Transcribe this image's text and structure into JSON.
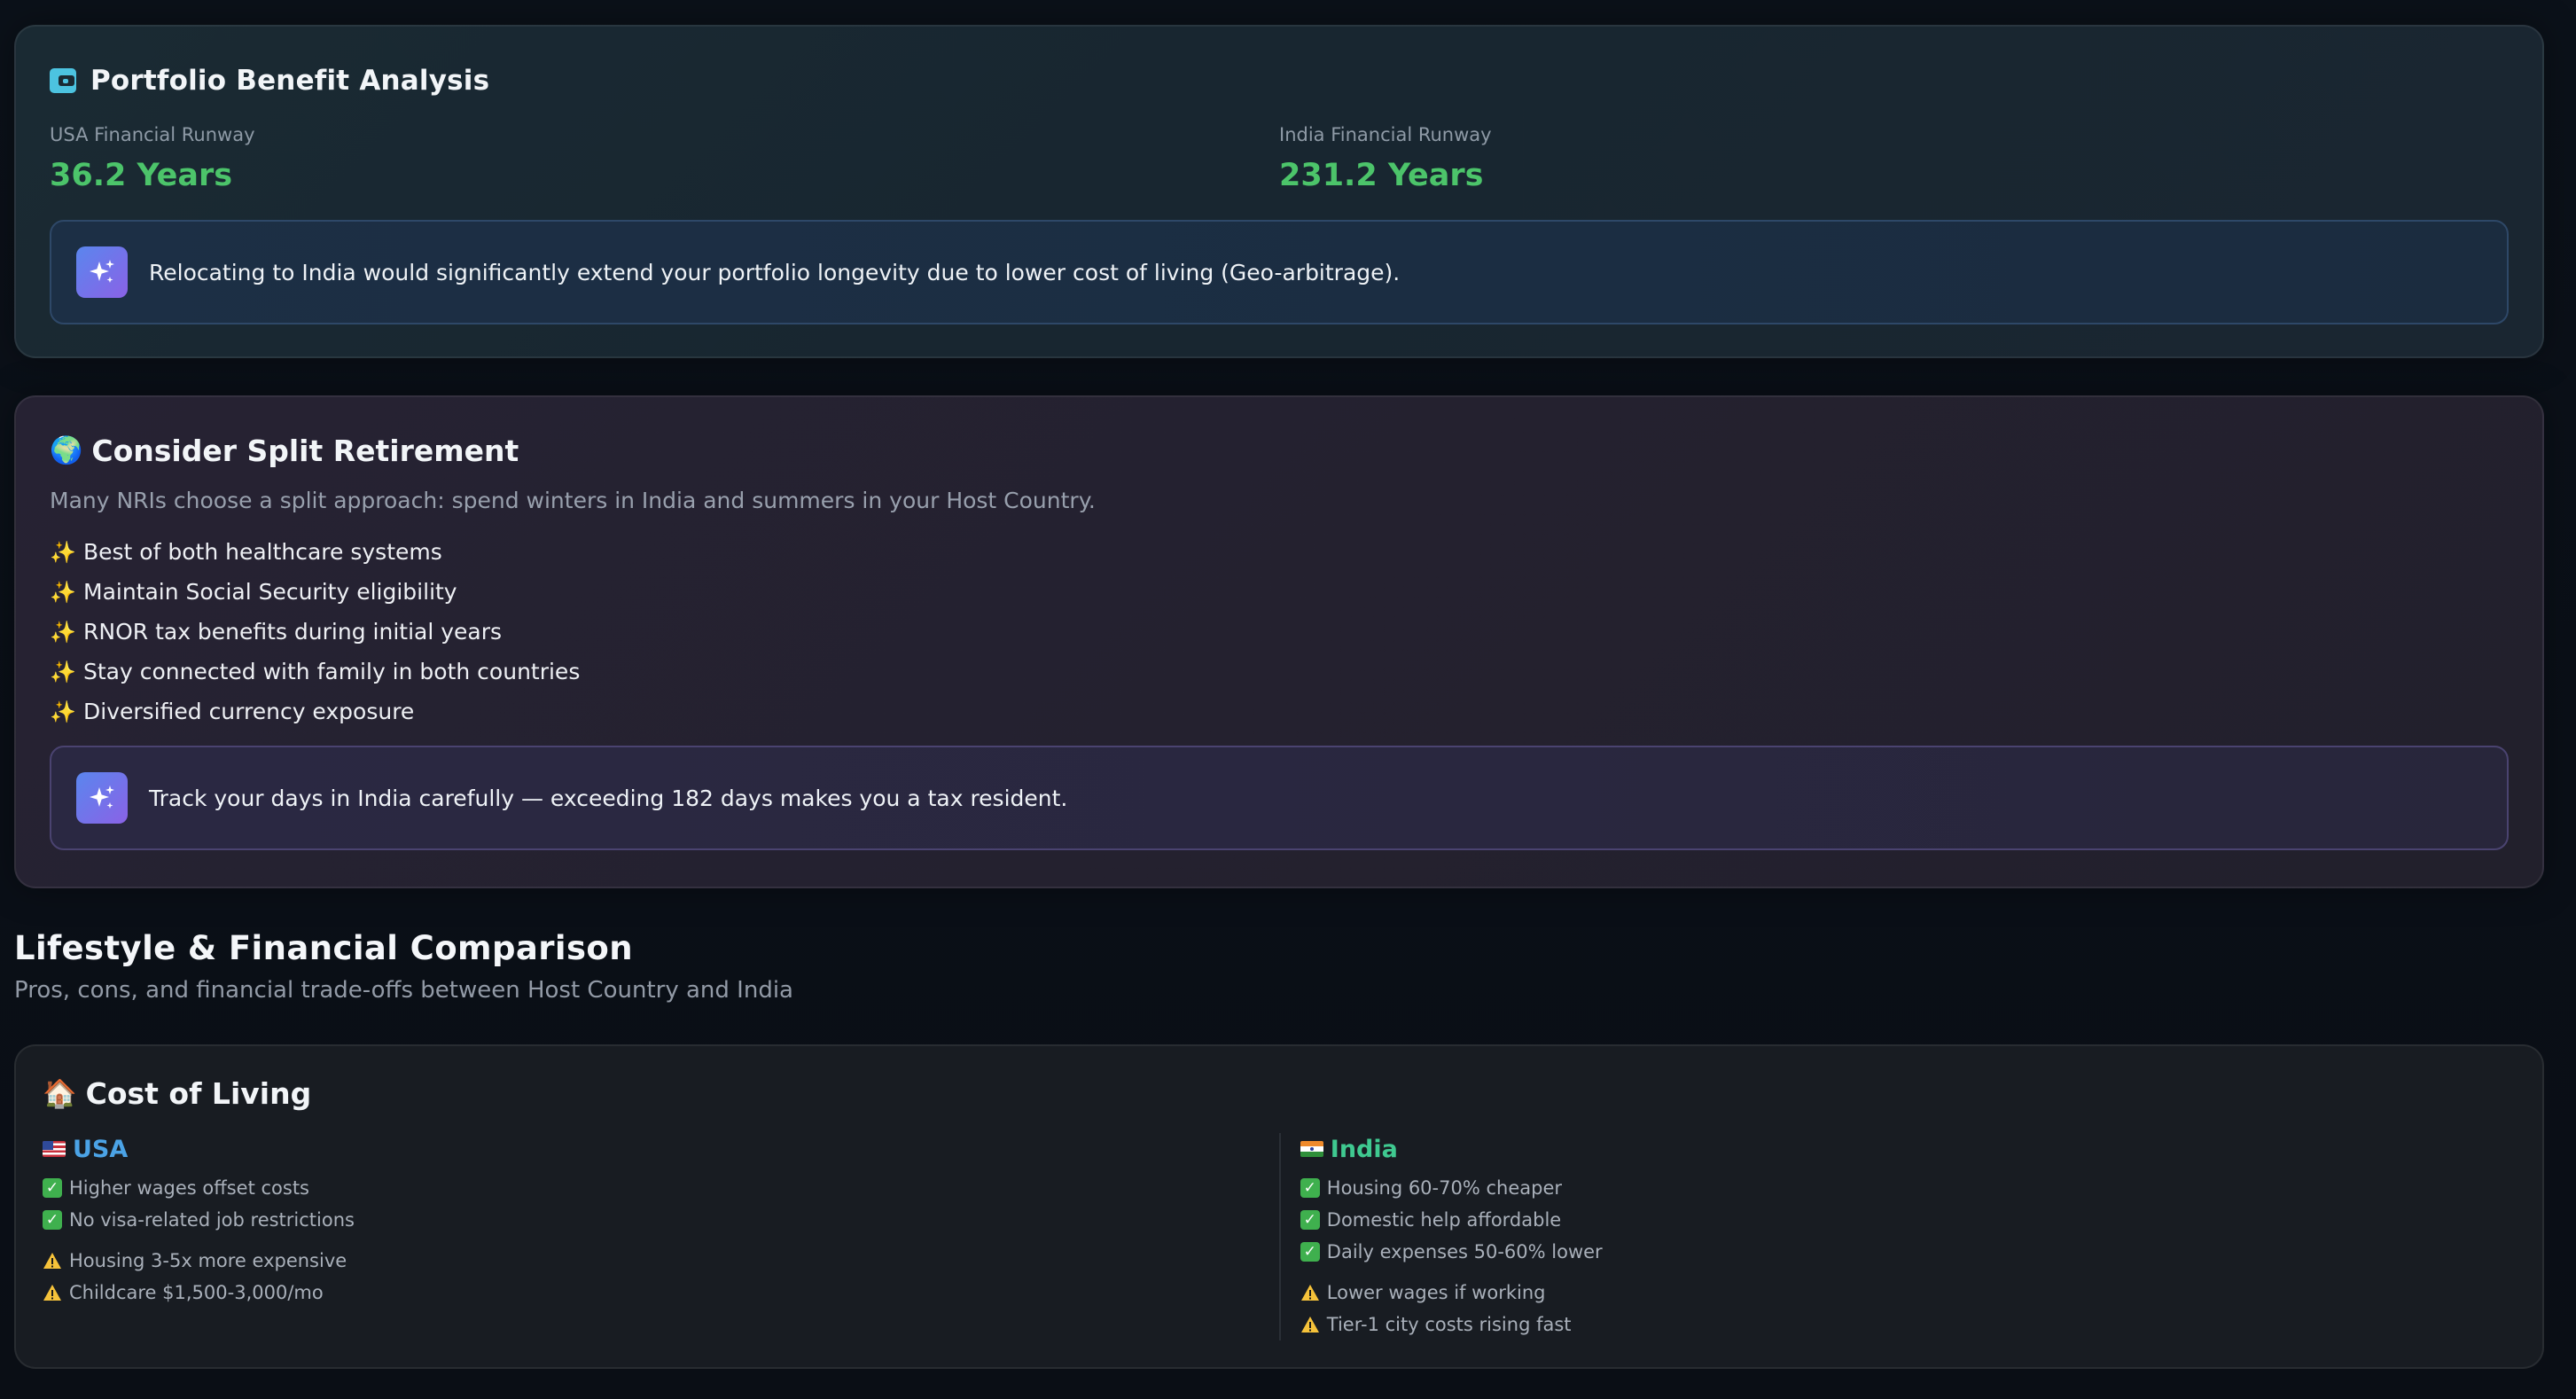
{
  "portfolio": {
    "title": "Portfolio Benefit Analysis",
    "icon": "wallet-icon",
    "usa_label": "USA Financial Runway",
    "usa_value": "36.2 Years",
    "india_label": "India Financial Runway",
    "india_value": "231.2 Years",
    "insight": "Relocating to India would significantly extend your portfolio longevity due to lower cost of living (Geo-arbitrage).",
    "accent_color": "#4cc46a"
  },
  "split": {
    "icon": "🌍",
    "title": "Consider Split Retirement",
    "intro": "Many NRIs choose a split approach: spend winters in India and summers in your Host Country.",
    "bullet_icon": "✨",
    "items": [
      "Best of both healthcare systems",
      "Maintain Social Security eligibility",
      "RNOR tax benefits during initial years",
      "Stay connected with family in both countries",
      "Diversified currency exposure"
    ],
    "insight": "Track your days in India carefully — exceeding 182 days makes you a tax resident."
  },
  "comparison": {
    "title": "Lifestyle & Financial Comparison",
    "subtitle": "Pros, cons, and financial trade-offs between Host Country and India"
  },
  "cost": {
    "icon": "🏠",
    "title": "Cost of Living",
    "usa": {
      "name": "USA",
      "color": "#4ba3e6",
      "pros": [
        "Higher wages offset costs",
        "No visa-related job restrictions"
      ],
      "cons": [
        "Housing 3-5x more expensive",
        "Childcare $1,500-3,000/mo"
      ]
    },
    "india": {
      "name": "India",
      "color": "#3fc990",
      "pros": [
        "Housing 60-70% cheaper",
        "Domestic help affordable",
        "Daily expenses 50-60% lower"
      ],
      "cons": [
        "Lower wages if working",
        "Tier-1 city costs rising fast"
      ]
    }
  }
}
